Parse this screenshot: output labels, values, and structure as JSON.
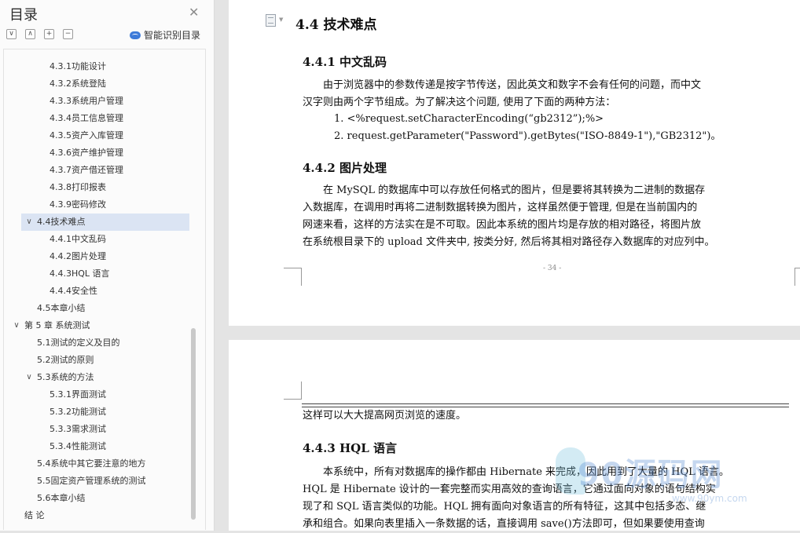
{
  "toc": {
    "title": "目录",
    "smart_label": "智能识别目录",
    "tools": [
      "∨",
      "∧",
      "+",
      "−"
    ],
    "items": [
      {
        "label": "4.3.1功能设计"
      },
      {
        "label": "4.3.2系统登陆"
      },
      {
        "label": "4.3.3系统用户管理"
      },
      {
        "label": "4.3.4员工信息管理"
      },
      {
        "label": "4.3.5资产入库管理"
      },
      {
        "label": "4.3.6资产维护管理"
      },
      {
        "label": "4.3.7资产借还管理"
      },
      {
        "label": "4.3.8打印报表"
      },
      {
        "label": "4.3.9密码修改"
      },
      {
        "label": "4.4技术难点"
      },
      {
        "label": "4.4.1中文乱码"
      },
      {
        "label": "4.4.2图片处理"
      },
      {
        "label": "4.4.3HQL 语言"
      },
      {
        "label": "4.4.4安全性"
      },
      {
        "label": "4.5本章小结"
      },
      {
        "label": "第 5 章  系统测试"
      },
      {
        "label": "5.1测试的定义及目的"
      },
      {
        "label": "5.2测试的原则"
      },
      {
        "label": "5.3系统的方法"
      },
      {
        "label": "5.3.1界面测试"
      },
      {
        "label": "5.3.2功能测试"
      },
      {
        "label": "5.3.3需求测试"
      },
      {
        "label": "5.3.4性能测试"
      },
      {
        "label": "5.4系统中其它要注意的地方"
      },
      {
        "label": "5.5固定资产管理系统的测试"
      },
      {
        "label": "5.6本章小结"
      },
      {
        "label": "结    论"
      }
    ]
  },
  "doc": {
    "h_44": "4.4  技术难点",
    "h_441": "4.4.1  中文乱码",
    "p_441": [
      "由于浏览器中的参数传递是按字节传送，因此英文和数字不会有任何的问题，而中文",
      "汉字则由两个字节组成。为了解决这个问题, 使用了下面的两种方法："
    ],
    "list": [
      "1.  <%request.setCharacterEncoding(“gb2312”);%>",
      "2.  request.getParameter(\"Password\").getBytes(\"ISO-8849-1\"),\"GB2312\")。"
    ],
    "h_442": "4.4.2  图片处理",
    "p_442": [
      "在 MySQL 的数据库中可以存放任何格式的图片，但是要将其转换为二进制的数据存",
      "入数据库，在调用时再将二进制数据转换为图片，这样虽然便于管理, 但是在当前国内的",
      "网速来看，这样的方法实在是不可取。因此本系统的图片均是存放的相对路径，将图片放",
      "在系统根目录下的 upload 文件夹中, 按类分好, 然后将其相对路径存入数据库的对应列中。"
    ],
    "page_number": "- 34 -",
    "p_cont": "这样可以大大提高网页浏览的速度。",
    "h_443": "4.4.3  HQL 语言",
    "p_443": [
      "本系统中，所有对数据库的操作都由 Hibernate 来完成，因此用到了大量的 HQL 语言。",
      "HQL 是 Hibernate 设计的一套完整而实用高效的查询语言，它通过面向对象的语句结构实",
      "现了和 SQL 语言类似的功能。HQL 拥有面向对象语言的所有特征，这其中包括多态、继",
      "承和组合。如果向表里插入一条数据的话，直接调用 save()方法即可，但如果要使用查询"
    ]
  },
  "watermark": {
    "main": "90源码网",
    "sub": "www.90ym.com"
  },
  "colors": {
    "selected_row": "#dbe4f3",
    "accent": "#3d7bd9"
  }
}
